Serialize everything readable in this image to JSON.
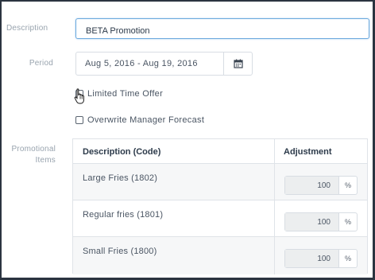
{
  "labels": {
    "description": "Description",
    "period": "Period",
    "promotional_items_line1": "Promotional",
    "promotional_items_line2": "Items"
  },
  "description_input": {
    "value": "BETA Promotion"
  },
  "period": {
    "value": "Aug 5, 2016 - Aug 19, 2016",
    "icon": "calendar-icon"
  },
  "options": {
    "limited_time_offer": {
      "label": "Limited Time Offer",
      "checked": false
    },
    "overwrite_forecast": {
      "label": "Overwrite Manager Forecast",
      "checked": false
    }
  },
  "items_table": {
    "headers": {
      "description": "Description (Code)",
      "adjustment": "Adjustment"
    },
    "rows": [
      {
        "name": "Large Fries (1802)",
        "adjustment": "100",
        "unit": "%"
      },
      {
        "name": "Regular fries (1801)",
        "adjustment": "100",
        "unit": "%"
      },
      {
        "name": "Small Fries (1800)",
        "adjustment": "100",
        "unit": "%"
      }
    ]
  },
  "colors": {
    "accent": "#6aa8dd",
    "border": "#2b3440",
    "label": "#98a3ae"
  }
}
